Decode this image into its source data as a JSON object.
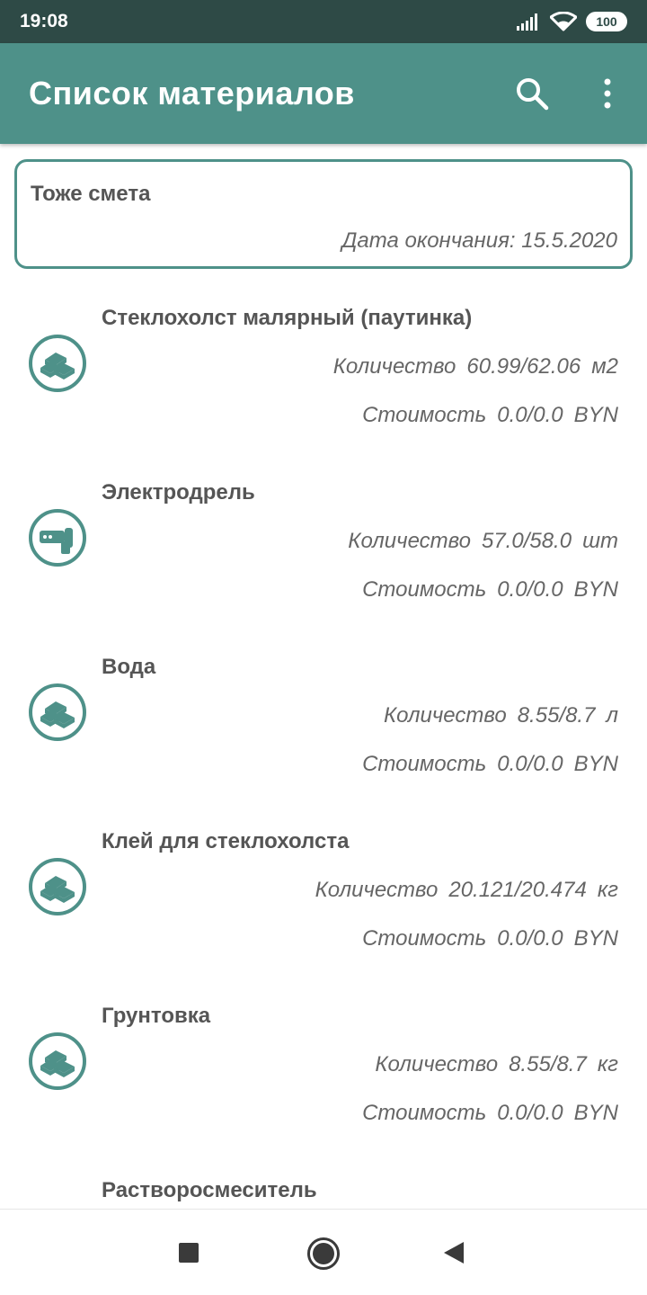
{
  "status_bar": {
    "time": "19:08",
    "battery": "100"
  },
  "app_bar": {
    "title": "Список материалов"
  },
  "estimate": {
    "name": "Тоже смета",
    "end_date": "Дата окончания: 15.5.2020"
  },
  "items": [
    {
      "name": "Стеклохолст малярный (паутинка)",
      "icon": "bricks-icon",
      "qty_label": "Количество",
      "qty_value": "60.99/62.06",
      "qty_unit": "м2",
      "cost_label": "Стоимость",
      "cost_value": "0.0/0.0",
      "cost_unit": "BYN"
    },
    {
      "name": "Электродрель",
      "icon": "drill-icon",
      "qty_label": "Количество",
      "qty_value": "57.0/58.0",
      "qty_unit": "шт",
      "cost_label": "Стоимость",
      "cost_value": "0.0/0.0",
      "cost_unit": "BYN"
    },
    {
      "name": "Вода",
      "icon": "bricks-icon",
      "qty_label": "Количество",
      "qty_value": "8.55/8.7",
      "qty_unit": "л",
      "cost_label": "Стоимость",
      "cost_value": "0.0/0.0",
      "cost_unit": "BYN"
    },
    {
      "name": "Клей для стеклохолста",
      "icon": "bricks-icon",
      "qty_label": "Количество",
      "qty_value": "20.121/20.474",
      "qty_unit": "кг",
      "cost_label": "Стоимость",
      "cost_value": "0.0/0.0",
      "cost_unit": "BYN"
    },
    {
      "name": "Грунтовка",
      "icon": "bricks-icon",
      "qty_label": "Количество",
      "qty_value": "8.55/8.7",
      "qty_unit": "кг",
      "cost_label": "Стоимость",
      "cost_value": "0.0/0.0",
      "cost_unit": "BYN"
    },
    {
      "name": "Растворосмеситель",
      "icon": "bricks-icon"
    }
  ],
  "colors": {
    "accent": "#4e9189",
    "status_bar": "#2e4a46",
    "text_primary": "#555555",
    "text_secondary": "#666666"
  }
}
